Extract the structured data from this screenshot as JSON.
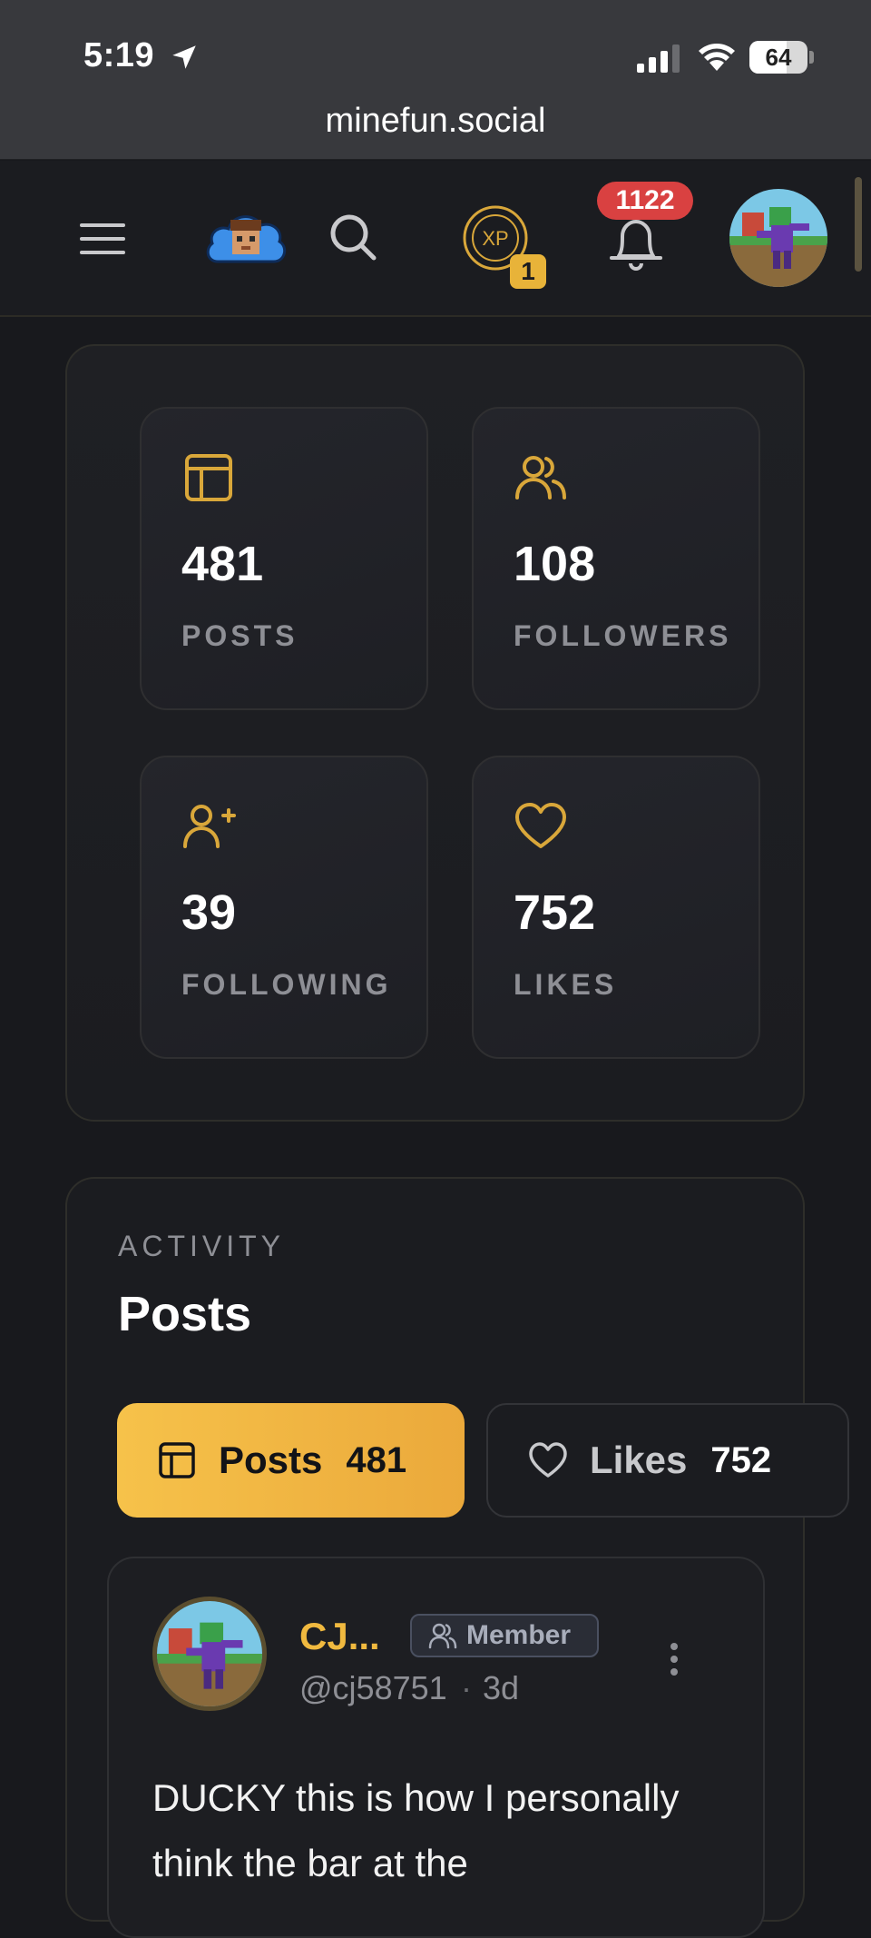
{
  "status_bar": {
    "time": "5:19",
    "battery": "64",
    "battery_level": 0.64
  },
  "browser": {
    "url": "minefun.social"
  },
  "header": {
    "xp_label": "XP",
    "xp_badge": "1",
    "notifications_count": "1122"
  },
  "stats": {
    "posts": {
      "value": "481",
      "label": "POSTS"
    },
    "followers": {
      "value": "108",
      "label": "FOLLOWERS"
    },
    "following": {
      "value": "39",
      "label": "FOLLOWING"
    },
    "likes": {
      "value": "752",
      "label": "LIKES"
    }
  },
  "activity": {
    "eyebrow": "ACTIVITY",
    "title": "Posts",
    "tabs": [
      {
        "label": "Posts",
        "count": "481",
        "active": true,
        "icon": "layout-icon"
      },
      {
        "label": "Likes",
        "count": "752",
        "active": false,
        "icon": "heart-icon"
      }
    ]
  },
  "post": {
    "author": "CJ...",
    "role": "Member",
    "handle": "@cj58751",
    "separator": "·",
    "time": "3d",
    "text": "DUCKY this is how I personally think the bar at the"
  },
  "colors": {
    "accent": "#f0b93f",
    "background": "#18191d",
    "notification": "#d94141"
  }
}
